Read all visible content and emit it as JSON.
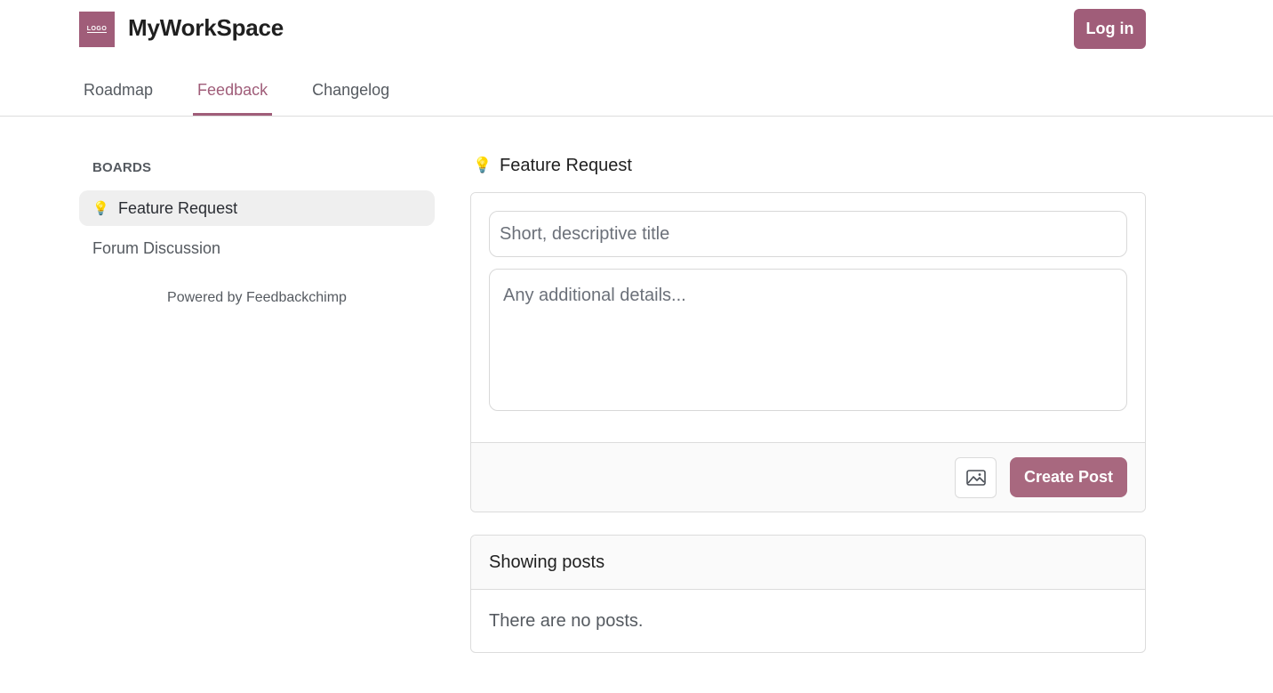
{
  "header": {
    "logo_text": "LOGO",
    "brand": "MyWorkSpace",
    "login_label": "Log in",
    "accent_color": "#a05d79"
  },
  "nav": {
    "tabs": [
      {
        "label": "Roadmap",
        "active": false
      },
      {
        "label": "Feedback",
        "active": true
      },
      {
        "label": "Changelog",
        "active": false
      }
    ]
  },
  "sidebar": {
    "section_label": "BOARDS",
    "boards": [
      {
        "label": "Feature Request",
        "icon": "lightbulb-icon",
        "emoji": "💡",
        "active": true
      },
      {
        "label": "Forum Discussion",
        "active": false
      }
    ],
    "powered_by": "Powered by Feedbackchimp"
  },
  "main": {
    "board_title": "Feature Request",
    "board_emoji": "💡",
    "form": {
      "title_placeholder": "Short, descriptive title",
      "title_value": "",
      "details_placeholder": "Any additional details...",
      "details_value": "",
      "image_button_icon": "image-icon",
      "create_label": "Create Post"
    },
    "posts": {
      "header": "Showing posts",
      "empty_text": "There are no posts."
    }
  }
}
